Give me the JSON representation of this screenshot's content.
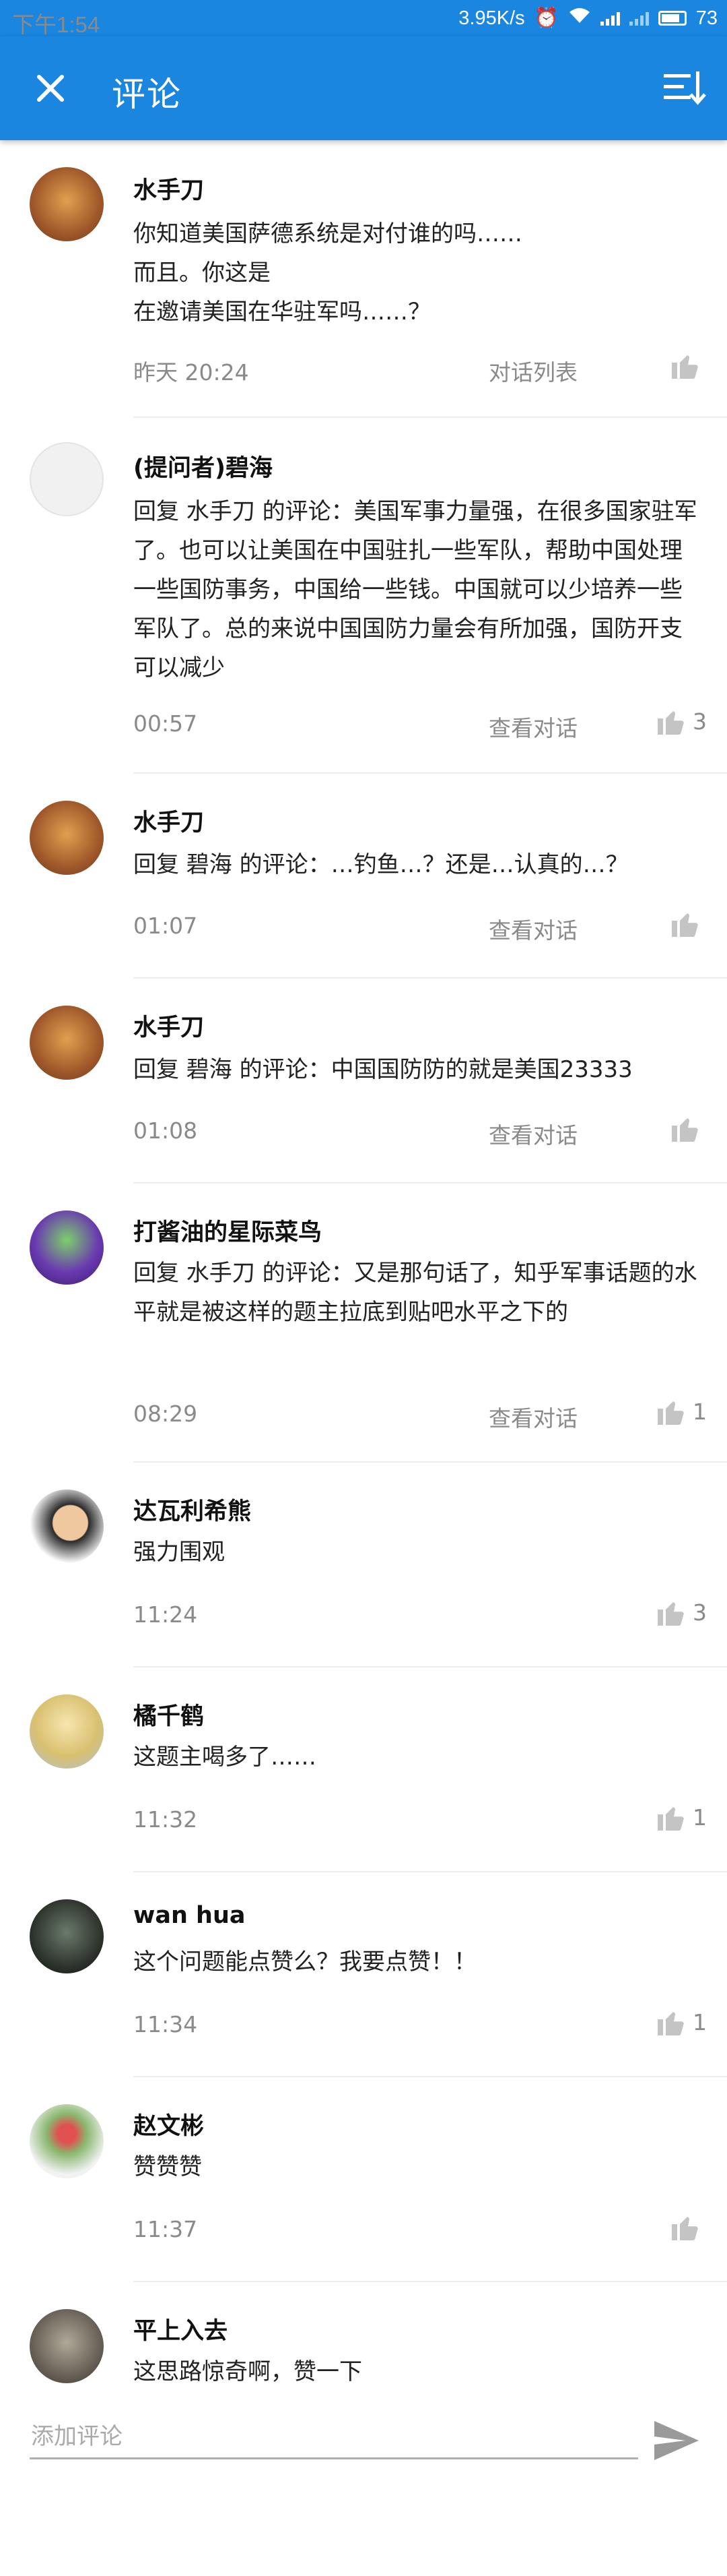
{
  "status_bar": {
    "time": "下午1:54",
    "speed": "3.95K/s",
    "battery": "73"
  },
  "header": {
    "title": "评论"
  },
  "comments": [
    {
      "name": "水手刀",
      "text": "你知道美国萨德系统是对付谁的吗……\n而且。你这是\n在邀请美国在华驻军吗……？",
      "time": "昨天 20:24",
      "action": "对话列表",
      "likes": ""
    },
    {
      "name": "(提问者)碧海",
      "text": "回复 水手刀 的评论：美国军事力量强，在很多国家驻军了。也可以让美国在中国驻扎一些军队，帮助中国处理一些国防事务，中国给一些钱。中国就可以少培养一些军队了。总的来说中国国防力量会有所加强，国防开支可以减少",
      "time": "00:57",
      "action": "查看对话",
      "likes": "3"
    },
    {
      "name": "水手刀",
      "text": "回复 碧海 的评论：…钓鱼…？还是…认真的…？",
      "time": "01:07",
      "action": "查看对话",
      "likes": ""
    },
    {
      "name": "水手刀",
      "text": "回复 碧海 的评论：中国国防防的就是美国23333",
      "time": "01:08",
      "action": "查看对话",
      "likes": ""
    },
    {
      "name": "打酱油的星际菜鸟",
      "text": "回复 水手刀 的评论：又是那句话了，知乎军事话题的水平就是被这样的题主拉底到贴吧水平之下的",
      "time": "08:29",
      "action": "查看对话",
      "likes": "1"
    },
    {
      "name": "达瓦利希熊",
      "text": "强力围观",
      "time": "11:24",
      "action": "",
      "likes": "3"
    },
    {
      "name": "橘千鹤",
      "text": "这题主喝多了……",
      "time": "11:32",
      "action": "",
      "likes": "1"
    },
    {
      "name": "wan hua",
      "text": "这个问题能点赞么？我要点赞！！",
      "time": "11:34",
      "action": "",
      "likes": "1"
    },
    {
      "name": "赵文彬",
      "text": "赞赞赞",
      "time": "11:37",
      "action": "",
      "likes": ""
    },
    {
      "name": "平上入去",
      "text": "这思路惊奇啊，赞一下",
      "time": "",
      "action": "",
      "likes": ""
    }
  ],
  "composer": {
    "placeholder": "添加评论"
  },
  "icons": {
    "close": "close-icon",
    "sort": "sort-icon",
    "like": "thumbs-up-icon",
    "send": "send-icon"
  },
  "colors": {
    "primary": "#1a86e0",
    "muted": "#8a8a8a"
  }
}
